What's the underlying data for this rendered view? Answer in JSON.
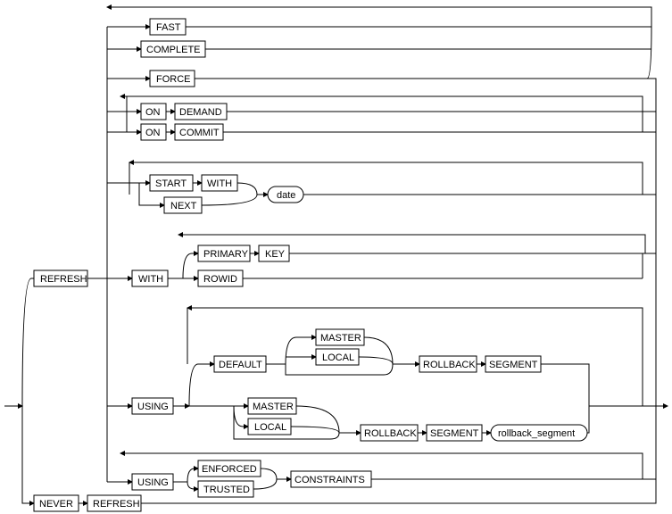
{
  "nodes": {
    "refresh1": "REFRESH",
    "fast": "FAST",
    "complete": "COMPLETE",
    "force": "FORCE",
    "on1": "ON",
    "demand": "DEMAND",
    "on2": "ON",
    "commit": "COMMIT",
    "start": "START",
    "with_s": "WITH",
    "next": "NEXT",
    "date": "date",
    "with_main": "WITH",
    "primary": "PRIMARY",
    "key": "KEY",
    "rowid": "ROWID",
    "using1": "USING",
    "default": "DEFAULT",
    "master1": "MASTER",
    "local1": "LOCAL",
    "rollback1": "ROLLBACK",
    "segment1": "SEGMENT",
    "master2": "MASTER",
    "local2": "LOCAL",
    "rollback2": "ROLLBACK",
    "segment2": "SEGMENT",
    "rb_seg": "rollback_segment",
    "using2": "USING",
    "enforced": "ENFORCED",
    "trusted": "TRUSTED",
    "constraints": "CONSTRAINTS",
    "never": "NEVER",
    "refresh2": "REFRESH"
  }
}
